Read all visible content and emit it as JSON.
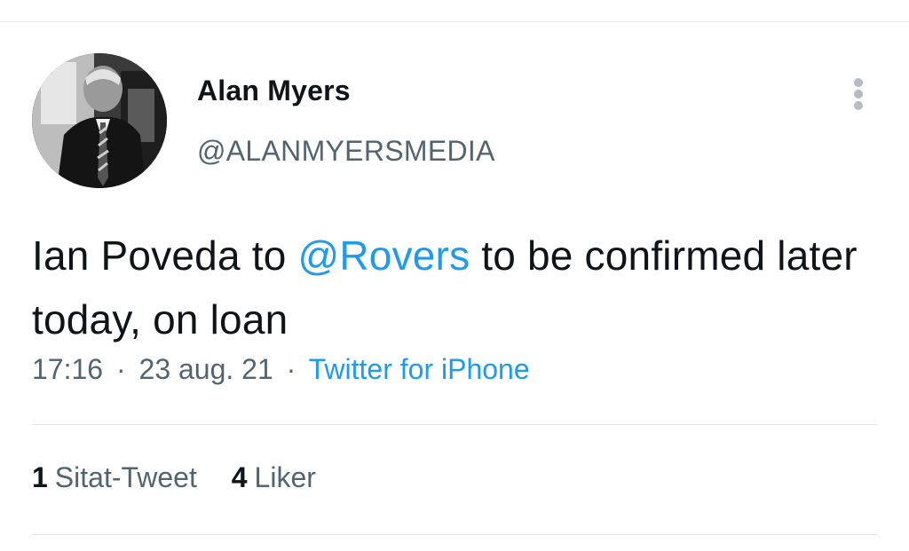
{
  "tweet": {
    "author": {
      "display_name": "Alan Myers",
      "handle": "@ALANMYERSMEDIA"
    },
    "text": {
      "before_mention": "Ian Poveda to ",
      "mention": "@Rovers",
      "after_mention": " to be confirmed later today, on loan"
    },
    "meta": {
      "time": "17:16",
      "separator": "·",
      "date": "23 aug. 21",
      "source": "Twitter for iPhone"
    },
    "stats": {
      "quote_count": "1",
      "quote_label": "Sitat-Tweet",
      "like_count": "4",
      "like_label": "Liker"
    }
  },
  "icons": {
    "more": "more-vertical-icon"
  },
  "colors": {
    "link": "#1d9bf0",
    "secondary_text": "#536471",
    "primary_text": "#0f1419"
  }
}
